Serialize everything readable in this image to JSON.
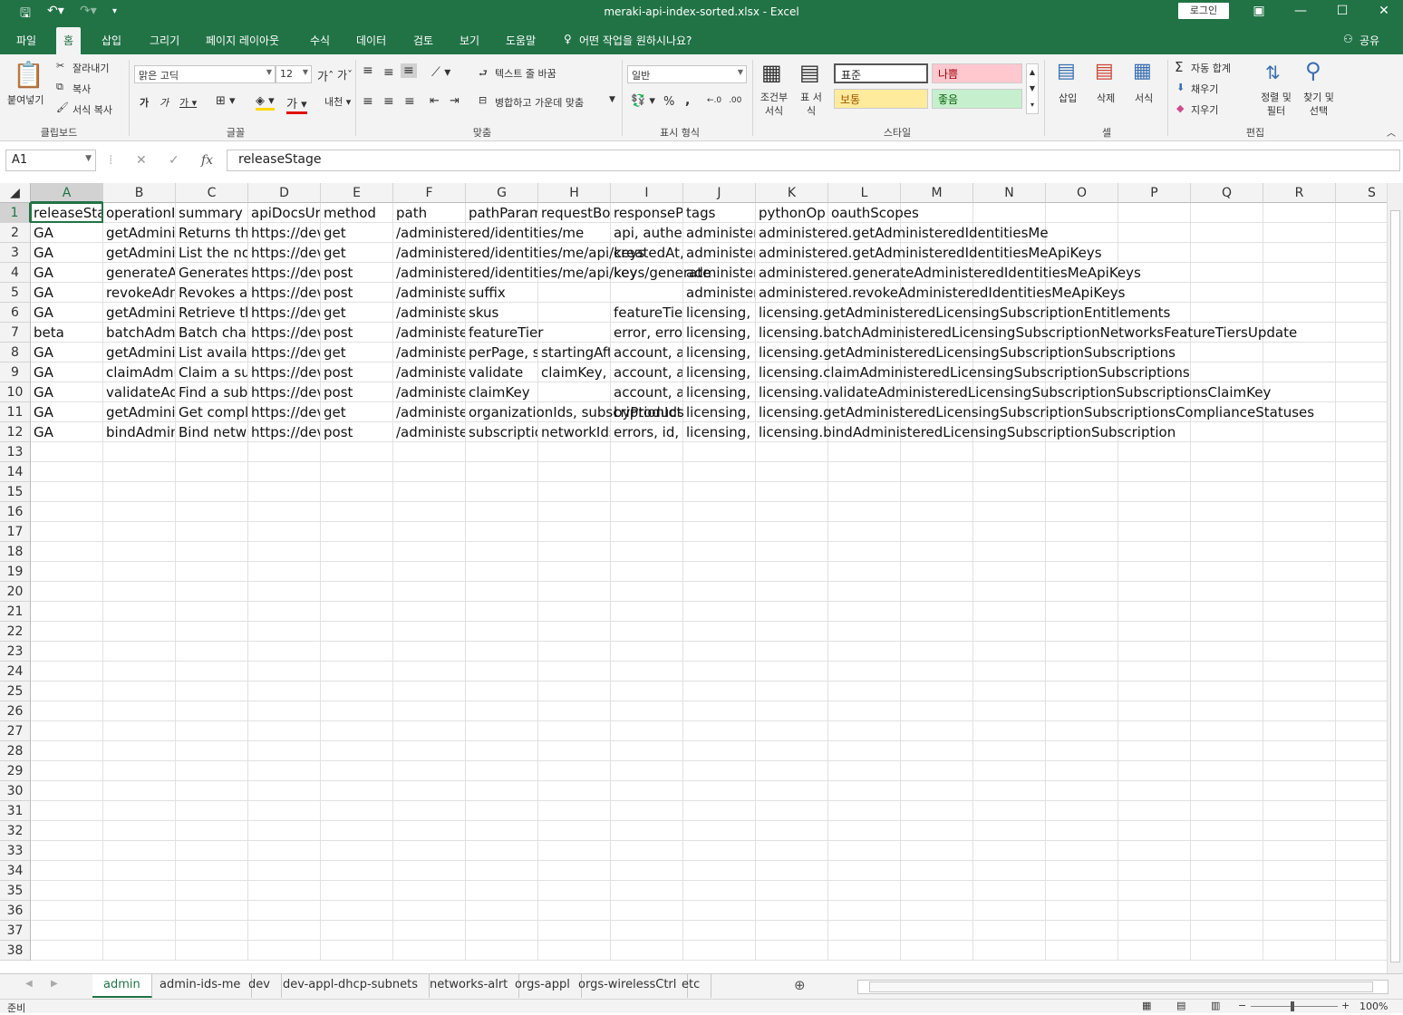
{
  "window": {
    "title": "meraki-api-index-sorted.xlsx  -  Excel",
    "login_label": "로그인",
    "accent": "#217346"
  },
  "ribbon_tabs": [
    "파일",
    "홈",
    "삽입",
    "그리기",
    "페이지 레이아웃",
    "수식",
    "데이터",
    "검토",
    "보기",
    "도움말"
  ],
  "tellme": "어떤 작업을 원하시나요?",
  "share": "공유",
  "ribbon": {
    "paste": "붙여넣기",
    "cut": "잘라내기",
    "copy": "복사",
    "format_painter": "서식 복사",
    "clipboard": "클립보드",
    "font_name": "맑은 고딕",
    "font_size": "12",
    "font": "글꼴",
    "wrap_text": "텍스트 줄 바꿈",
    "merge_center": "병합하고 가운데 맞춤",
    "alignment": "맞춤",
    "number_format": "일반",
    "number": "표시 형식",
    "cond_format": "조건부 서식",
    "table_format": "표 서식",
    "style_normal": "표준",
    "style_bad": "나쁨",
    "style_neutral": "보통",
    "style_good": "좋음",
    "styles": "스타일",
    "insert": "삽입",
    "delete": "삭제",
    "format": "서식",
    "cells": "셀",
    "autosum": "자동 합계",
    "fill": "채우기",
    "clear": "지우기",
    "sort_filter": "정렬 및 필터",
    "find_select": "찾기 및 선택",
    "editing": "편집",
    "percent": "%",
    "comma": ","
  },
  "formula": {
    "namebox": "A1",
    "fx": "fx",
    "value": "releaseStage"
  },
  "columns": [
    "A",
    "B",
    "C",
    "D",
    "E",
    "F",
    "G",
    "H",
    "I",
    "J",
    "K",
    "L",
    "M",
    "N",
    "O",
    "P",
    "Q",
    "R",
    "S"
  ],
  "rows": [
    [
      "releaseStage",
      "operationId",
      "summary",
      "apiDocsUrl",
      "method",
      "path",
      "pathParams",
      "requestBody",
      "responseProps",
      "tags",
      "pythonOp",
      "oauthScopes"
    ],
    [
      "GA",
      "getAdministeredIdentitiesMe",
      "Returns the identity of the current user.",
      "https://developer.cisco.com",
      "get",
      "/administered/identities/me",
      "",
      "",
      "api, authentication",
      "administered",
      "administered.getAdministeredIdentitiesMe",
      ""
    ],
    [
      "GA",
      "getAdministeredIdentitiesMeApiKeys",
      "List the non-sensitive metadata",
      "https://developer.cisco.com",
      "get",
      "/administered/identities/me/api/keys",
      "",
      "",
      "createdAt, key",
      "administered",
      "administered.getAdministeredIdentitiesMeApiKeys",
      ""
    ],
    [
      "GA",
      "generateAdministeredIdentitiesMeApiKeys",
      "Generates an API key",
      "https://developer.cisco.com",
      "post",
      "/administered/identities/me/api/keys/generate",
      "",
      "",
      "key",
      "administered",
      "administered.generateAdministeredIdentitiesMeApiKeys",
      ""
    ],
    [
      "GA",
      "revokeAdministeredIdentitiesMeApiKeys",
      "Revokes an API key",
      "https://developer.cisco.com",
      "post",
      "/administered/identities/me/api/keys/{suffix}/revoke",
      "suffix",
      "",
      "",
      "administered",
      "administered.revokeAdministeredIdentitiesMeApiKeys",
      ""
    ],
    [
      "GA",
      "getAdministeredLicensingSubscriptionEntitlements",
      "Retrieve the list of entitlements",
      "https://developer.cisco.com",
      "get",
      "/administered/licensing/subscription/entitlements",
      "skus",
      "",
      "featureTier",
      "licensing, subscription",
      "licensing.getAdministeredLicensingSubscriptionEntitlements",
      ""
    ],
    [
      "beta",
      "batchAdministeredLicensingSubscriptionNetworksFeatureTiersUpdate",
      "Batch change networks",
      "https://developer.cisco.com",
      "post",
      "/administered/licensing/subscription/networks/featureTiers/batchUpdate",
      "featureTier",
      "",
      "error, errors",
      "licensing, subscription",
      "licensing.batchAdministeredLicensingSubscriptionNetworksFeatureTiersUpdate",
      ""
    ],
    [
      "GA",
      "getAdministeredLicensingSubscriptionSubscriptions",
      "List available subscriptions",
      "https://developer.cisco.com",
      "get",
      "/administered/licensing/subscription/subscriptions",
      "perPage, startingAfter",
      "startingAfter",
      "account, active",
      "licensing, subscription",
      "licensing.getAdministeredLicensingSubscriptionSubscriptions",
      ""
    ],
    [
      "GA",
      "claimAdministeredLicensingSubscriptionSubscriptions",
      "Claim a subscription",
      "https://developer.cisco.com",
      "post",
      "/administered/licensing/subscription/subscriptions/claim",
      "validate",
      "claimKey, description",
      "account, active",
      "licensing, subscription",
      "licensing.claimAdministeredLicensingSubscriptionSubscriptions",
      ""
    ],
    [
      "GA",
      "validateAdministeredLicensingSubscriptionSubscriptionsClaimKey",
      "Find a subscription by claim key",
      "https://developer.cisco.com",
      "post",
      "/administered/licensing/subscription/subscriptions/claimKey/validate",
      "claimKey",
      "",
      "account, active",
      "licensing, subscription",
      "licensing.validateAdministeredLicensingSubscriptionSubscriptionsClaimKey",
      ""
    ],
    [
      "GA",
      "getAdministeredLicensingSubscriptionSubscriptionsComplianceStatuses",
      "Get compliance status",
      "https://developer.cisco.com",
      "get",
      "/administered/licensing/subscription/subscriptions/compliance/statuses",
      "organizationIds, subscriptionIds",
      "",
      "byProduct",
      "licensing, subscription",
      "licensing.getAdministeredLicensingSubscriptionSubscriptionsComplianceStatuses",
      ""
    ],
    [
      "GA",
      "bindAdministeredLicensingSubscriptionSubscription",
      "Bind networks to a subscription",
      "https://developer.cisco.com",
      "post",
      "/administered/licensing/subscription/subscriptions/{subscriptionId}/bind",
      "subscriptionId",
      "networkIds",
      "errors, id, name",
      "licensing, subscription",
      "licensing.bindAdministeredLicensingSubscriptionSubscription",
      ""
    ]
  ],
  "row_numbers": [
    "1",
    "2",
    "3",
    "4",
    "5",
    "6",
    "7",
    "8",
    "9",
    "10",
    "11",
    "12",
    "13",
    "14",
    "15",
    "16",
    "17",
    "18",
    "19",
    "20",
    "21",
    "22",
    "23",
    "24",
    "25",
    "26",
    "27",
    "28",
    "29",
    "30",
    "31",
    "32",
    "33",
    "34",
    "35",
    "36",
    "37",
    "38"
  ],
  "sheets": [
    "admin",
    "admin-ids-me",
    "dev",
    "dev-appl-dhcp-subnets",
    "networks-alrt",
    "orgs-appl",
    "orgs-wirelessCtrl",
    "etc"
  ],
  "active_sheet": "admin",
  "status": {
    "ready": "준비",
    "zoom": "100%"
  }
}
